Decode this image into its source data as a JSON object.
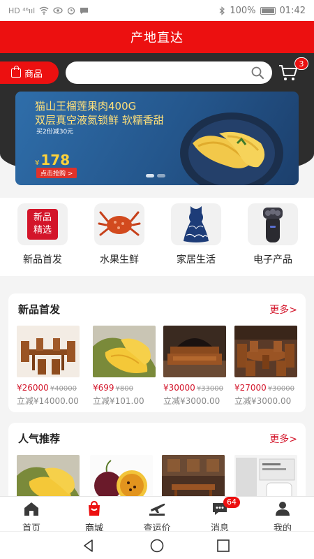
{
  "status_bar": {
    "left": "HD ⁴⁶ııl",
    "battery": "100%",
    "time": "01:42"
  },
  "header": {
    "title": "产地直达"
  },
  "search": {
    "category_label": "商品",
    "placeholder": "",
    "cart_count": "3"
  },
  "banner": {
    "title_line1": "猫山王榴莲果肉400G",
    "title_line2": "双层真空液氮锁鲜 软糯香甜",
    "promo": "买2份减30元",
    "currency": "¥",
    "price": "178",
    "buy_label": "点击抢购 >"
  },
  "categories": [
    {
      "label": "新品首发",
      "icon": "new-products-icon",
      "tag_line1": "新品",
      "tag_line2": "精选"
    },
    {
      "label": "水果生鲜",
      "icon": "crab-icon"
    },
    {
      "label": "家居生活",
      "icon": "dress-icon"
    },
    {
      "label": "电子产品",
      "icon": "shaver-icon"
    }
  ],
  "new_section": {
    "title": "新品首发",
    "more": "更多>",
    "products": [
      {
        "price": "¥26000",
        "old_price": "¥40000",
        "saving": "立减¥14000.00",
        "image": "wooden-dining-set"
      },
      {
        "price": "¥699",
        "old_price": "¥800",
        "saving": "立减¥101.00",
        "image": "durian"
      },
      {
        "price": "¥30000",
        "old_price": "¥33000",
        "saving": "立减¥3000.00",
        "image": "wooden-bed"
      },
      {
        "price": "¥27000",
        "old_price": "¥30000",
        "saving": "立减¥3000.00",
        "image": "round-dining-set"
      }
    ]
  },
  "popular_section": {
    "title": "人气推荐",
    "more": "更多>",
    "products": [
      {
        "image": "durian"
      },
      {
        "image": "passion-fruit"
      },
      {
        "image": "wooden-furniture"
      },
      {
        "image": "kohler-toilet"
      }
    ]
  },
  "tabbar": [
    {
      "label": "首页",
      "icon": "home-icon",
      "active": false
    },
    {
      "label": "商城",
      "icon": "mall-icon",
      "active": true
    },
    {
      "label": "查运价",
      "icon": "plane-icon",
      "active": false
    },
    {
      "label": "消息",
      "icon": "message-icon",
      "active": false,
      "badge": "64"
    },
    {
      "label": "我的",
      "icon": "user-icon",
      "active": false
    }
  ],
  "colors": {
    "brand_red": "#ec1010",
    "dark_band": "#2d2d2d",
    "price_red": "#d3152a"
  }
}
